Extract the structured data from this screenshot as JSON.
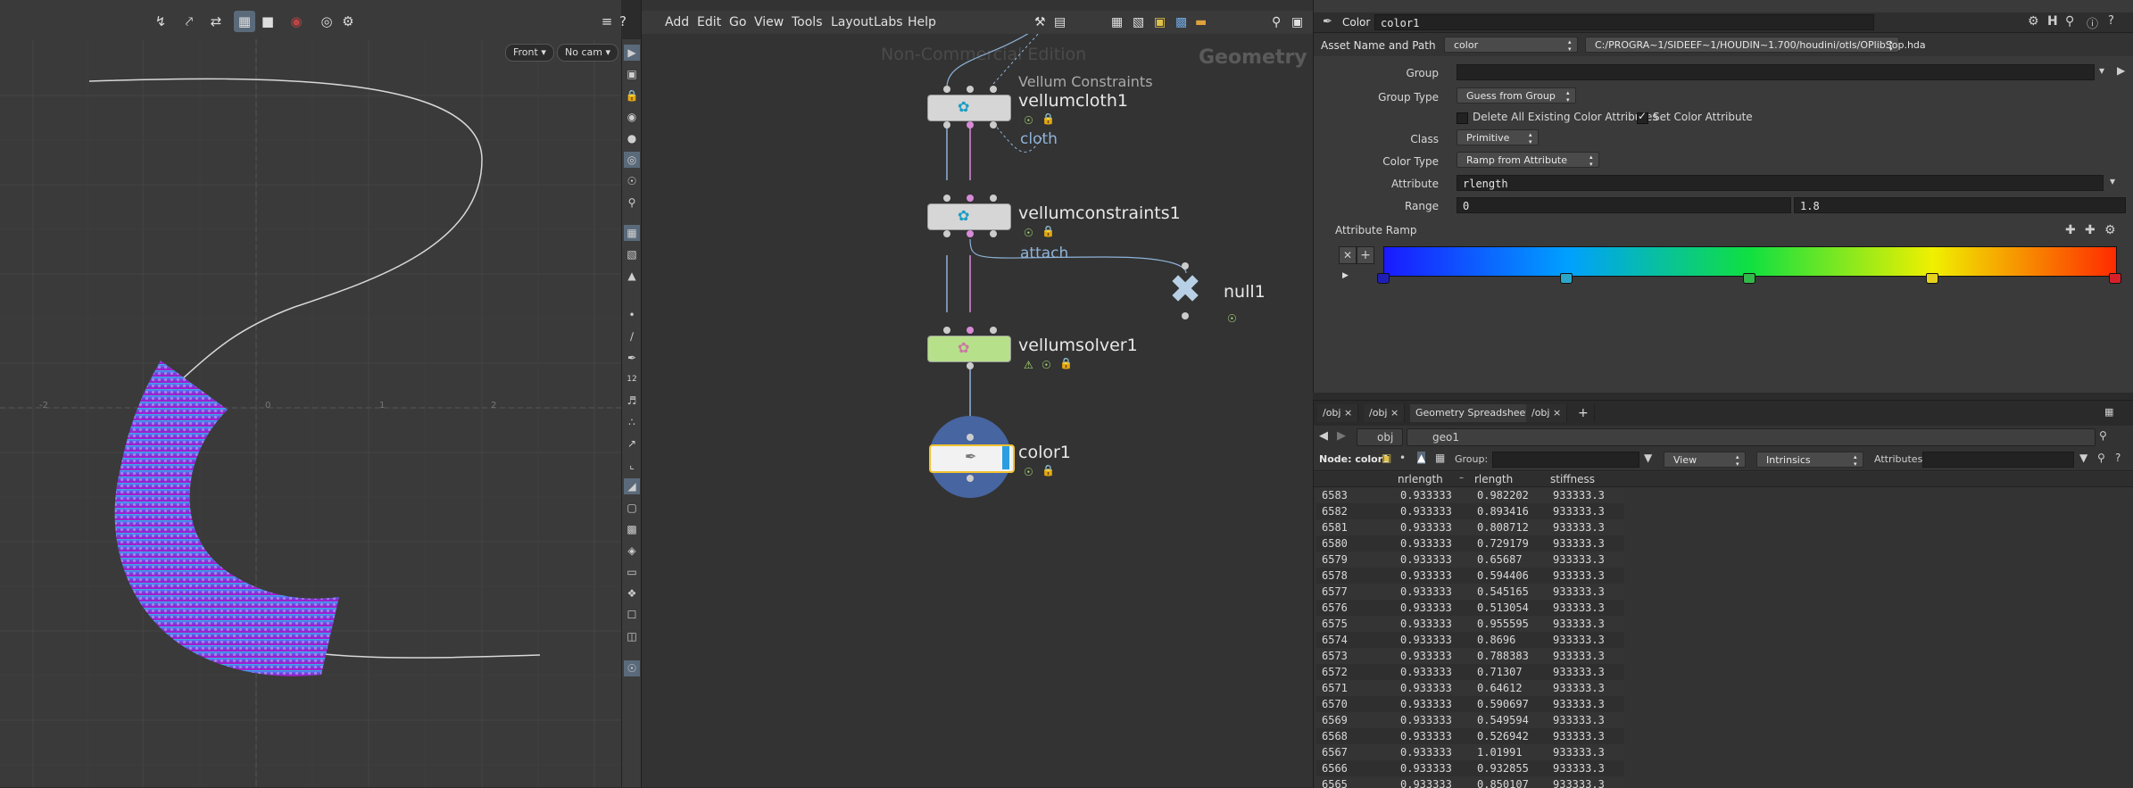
{
  "viewport": {
    "view_label": "Front",
    "cam_label": "No cam",
    "toolbar_icons": [
      "snap-icon",
      "select-icon",
      "transform-icon",
      "show-handle-icon",
      "stop-icon",
      "record-icon",
      "camera-icon",
      "gear-icon"
    ],
    "axis_ticks": [
      "-2",
      "0",
      "1",
      "2"
    ]
  },
  "network": {
    "menu": [
      "Add",
      "Edit",
      "Go",
      "View",
      "Tools",
      "Layout",
      "Labs",
      "Help"
    ],
    "watermark": "Non-Commercial Edition",
    "context_label": "Geometry",
    "nodes": [
      {
        "name": "vellumcloth1",
        "comment": "Vellum Constraints",
        "output_label": "cloth"
      },
      {
        "name": "vellumconstraints1",
        "output_label": "attach"
      },
      {
        "name": "vellumsolver1"
      },
      {
        "name": "null1"
      },
      {
        "name": "color1"
      }
    ],
    "colors": {
      "cloth_node": "#d6d6d6",
      "solver_node": "#b7e08b",
      "color_node": "#f2f2f2",
      "selected_ring": "#4a6fb5",
      "wire_blue": "#8fb3d9",
      "wire_pink": "#d88ad8"
    }
  },
  "params": {
    "node_type": "Color",
    "node_name": "color1",
    "asset_label": "Asset Name and Path",
    "asset_name": "color",
    "asset_path": "C:/PROGRA~1/SIDEEF~1/HOUDIN~1.700/houdini/otls/OPlibSop.hda",
    "group_label": "Group",
    "group_value": "",
    "group_type_label": "Group Type",
    "group_type_value": "Guess from Group",
    "delete_attrs_label": "Delete All Existing Color Attributes",
    "set_color_label": "Set Color Attribute",
    "class_label": "Class",
    "class_value": "Primitive",
    "color_type_label": "Color Type",
    "color_type_value": "Ramp from Attribute",
    "attribute_label": "Attribute",
    "attribute_value": "rlength",
    "range_label": "Range",
    "range_min": "0",
    "range_max": "1.8",
    "ramp_label": "Attribute Ramp",
    "ramp_keys": [
      0.0,
      0.25,
      0.5,
      0.75,
      1.0
    ],
    "ramp_key_colors": [
      "#1e1eb4",
      "#2aa6c8",
      "#33b84a",
      "#e6d21e",
      "#d8202a"
    ]
  },
  "sheet": {
    "tabs": [
      "/obj",
      "/obj",
      "Geometry Spreadsheet",
      "/obj"
    ],
    "path_obj": "obj",
    "path_geo": "geo1",
    "node_label": "Node: color1",
    "group_label": "Group:",
    "view_label": "View",
    "intrinsics_label": "Intrinsics",
    "attributes_label": "Attributes:",
    "columns": [
      "nrlength",
      "rlength",
      "stiffness"
    ],
    "rows": [
      [
        "6583",
        "0.933333",
        "0.982202",
        "933333.3"
      ],
      [
        "6582",
        "0.933333",
        "0.893416",
        "933333.3"
      ],
      [
        "6581",
        "0.933333",
        "0.808712",
        "933333.3"
      ],
      [
        "6580",
        "0.933333",
        "0.729179",
        "933333.3"
      ],
      [
        "6579",
        "0.933333",
        "0.65687",
        "933333.3"
      ],
      [
        "6578",
        "0.933333",
        "0.594406",
        "933333.3"
      ],
      [
        "6577",
        "0.933333",
        "0.545165",
        "933333.3"
      ],
      [
        "6576",
        "0.933333",
        "0.513054",
        "933333.3"
      ],
      [
        "6575",
        "0.933333",
        "0.955595",
        "933333.3"
      ],
      [
        "6574",
        "0.933333",
        "0.8696",
        "933333.3"
      ],
      [
        "6573",
        "0.933333",
        "0.788383",
        "933333.3"
      ],
      [
        "6572",
        "0.933333",
        "0.71307",
        "933333.3"
      ],
      [
        "6571",
        "0.933333",
        "0.64612",
        "933333.3"
      ],
      [
        "6570",
        "0.933333",
        "0.590697",
        "933333.3"
      ],
      [
        "6569",
        "0.933333",
        "0.549594",
        "933333.3"
      ],
      [
        "6568",
        "0.933333",
        "0.526942",
        "933333.3"
      ],
      [
        "6567",
        "0.933333",
        "1.01991",
        "933333.3"
      ],
      [
        "6566",
        "0.933333",
        "0.932855",
        "933333.3"
      ],
      [
        "6565",
        "0.933333",
        "0.850107",
        "933333.3"
      ]
    ]
  }
}
